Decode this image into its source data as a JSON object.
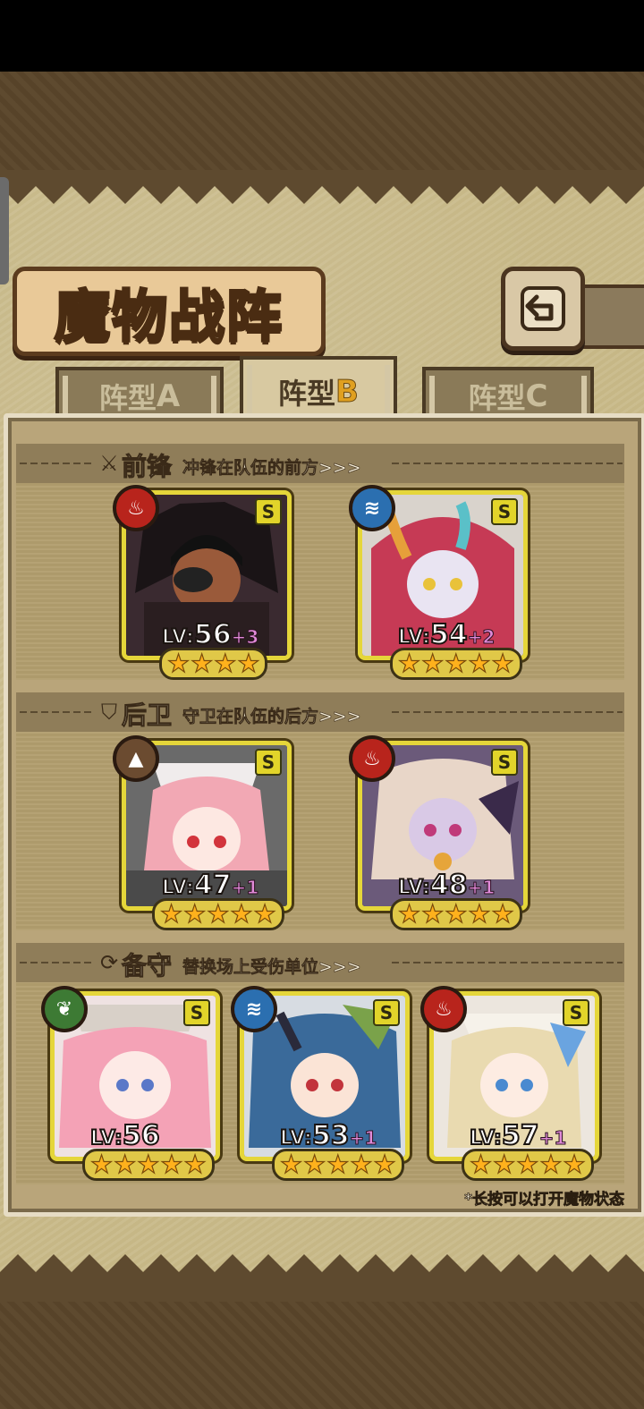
{
  "title": "魔物战阵",
  "tabs": [
    {
      "label": "阵型",
      "letter": "A",
      "active": false
    },
    {
      "label": "阵型",
      "letter": "B",
      "active": true
    },
    {
      "label": "阵型",
      "letter": "C",
      "active": false
    }
  ],
  "sections": {
    "front": {
      "title": "前锋",
      "desc": "冲锋在队伍的前方>>>",
      "icon": "sword-icon"
    },
    "back": {
      "title": "后卫",
      "desc": "守卫在队伍的后方>>>",
      "icon": "shield-icon"
    },
    "reserve": {
      "title": "备守",
      "desc": "替换场上受伤单位>>>",
      "icon": "swap-icon"
    }
  },
  "cards": {
    "front_1": {
      "level": "56",
      "bonus": "+3",
      "rank": "S",
      "element": "fire",
      "stars": 4,
      "lv_label": "LV:"
    },
    "front_2": {
      "level": "54",
      "bonus": "+2",
      "rank": "S",
      "element": "water",
      "stars": 5,
      "lv_label": "LV:"
    },
    "back_1": {
      "level": "47",
      "bonus": "+1",
      "rank": "S",
      "element": "earth",
      "stars": 5,
      "lv_label": "LV:"
    },
    "back_2": {
      "level": "48",
      "bonus": "+1",
      "rank": "S",
      "element": "fire",
      "stars": 5,
      "lv_label": "LV:"
    },
    "reserve_1": {
      "level": "56",
      "bonus": "",
      "rank": "S",
      "element": "wind",
      "stars": 5,
      "lv_label": "LV:"
    },
    "reserve_2": {
      "level": "53",
      "bonus": "+1",
      "rank": "S",
      "element": "water",
      "stars": 5,
      "lv_label": "LV:"
    },
    "reserve_3": {
      "level": "57",
      "bonus": "+1",
      "rank": "S",
      "element": "fire",
      "stars": 5,
      "lv_label": "LV:"
    }
  },
  "footnote": "*长按可以打开魔物状态",
  "colors": {
    "fire": "#b8241c",
    "water": "#2b6fb0",
    "earth": "#6b4b30",
    "wind": "#3d7a34",
    "card_border": "#e5d63a"
  }
}
